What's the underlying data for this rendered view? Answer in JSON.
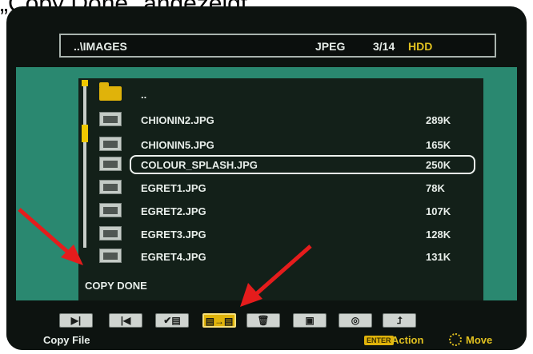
{
  "caption": "„Copy Done\" angezeigt.",
  "topbar": {
    "path": "..\\IMAGES",
    "format": "JPEG",
    "count": "3/14",
    "device": "HDD"
  },
  "files": [
    {
      "name": "..",
      "size": "",
      "type": "folder"
    },
    {
      "name": "CHIONIN2.JPG",
      "size": "289K",
      "type": "file"
    },
    {
      "name": "CHIONIN5.JPG",
      "size": "165K",
      "type": "file"
    },
    {
      "name": "COLOUR_SPLASH.JPG",
      "size": "250K",
      "type": "file",
      "selected": true
    },
    {
      "name": "EGRET1.JPG",
      "size": "78K",
      "type": "file"
    },
    {
      "name": "EGRET2.JPG",
      "size": "107K",
      "type": "file"
    },
    {
      "name": "EGRET3.JPG",
      "size": "128K",
      "type": "file"
    },
    {
      "name": "EGRET4.JPG",
      "size": "131K",
      "type": "file"
    }
  ],
  "status": "COPY DONE",
  "toolbar": {
    "buttons": [
      {
        "icon": "play-next-icon",
        "glyph": "▶|"
      },
      {
        "icon": "prev-icon",
        "glyph": "|◀"
      },
      {
        "icon": "check-select-icon",
        "glyph": "✔▤"
      },
      {
        "icon": "copy-file-icon",
        "glyph": "▤→▤",
        "active": true
      },
      {
        "icon": "trash-icon",
        "glyph": "🗑"
      },
      {
        "icon": "slideshow-icon",
        "glyph": "▣"
      },
      {
        "icon": "zoom-icon",
        "glyph": "◎"
      },
      {
        "icon": "back-up-icon",
        "glyph": "⮥"
      }
    ]
  },
  "footer": {
    "hint": "Copy File",
    "enter_key": "ENTER",
    "action": "Action",
    "move": "Move"
  },
  "colors": {
    "teal": "#2a8870",
    "panel": "#132019",
    "accent": "#e0c020",
    "arrow": "#e51c1c"
  }
}
